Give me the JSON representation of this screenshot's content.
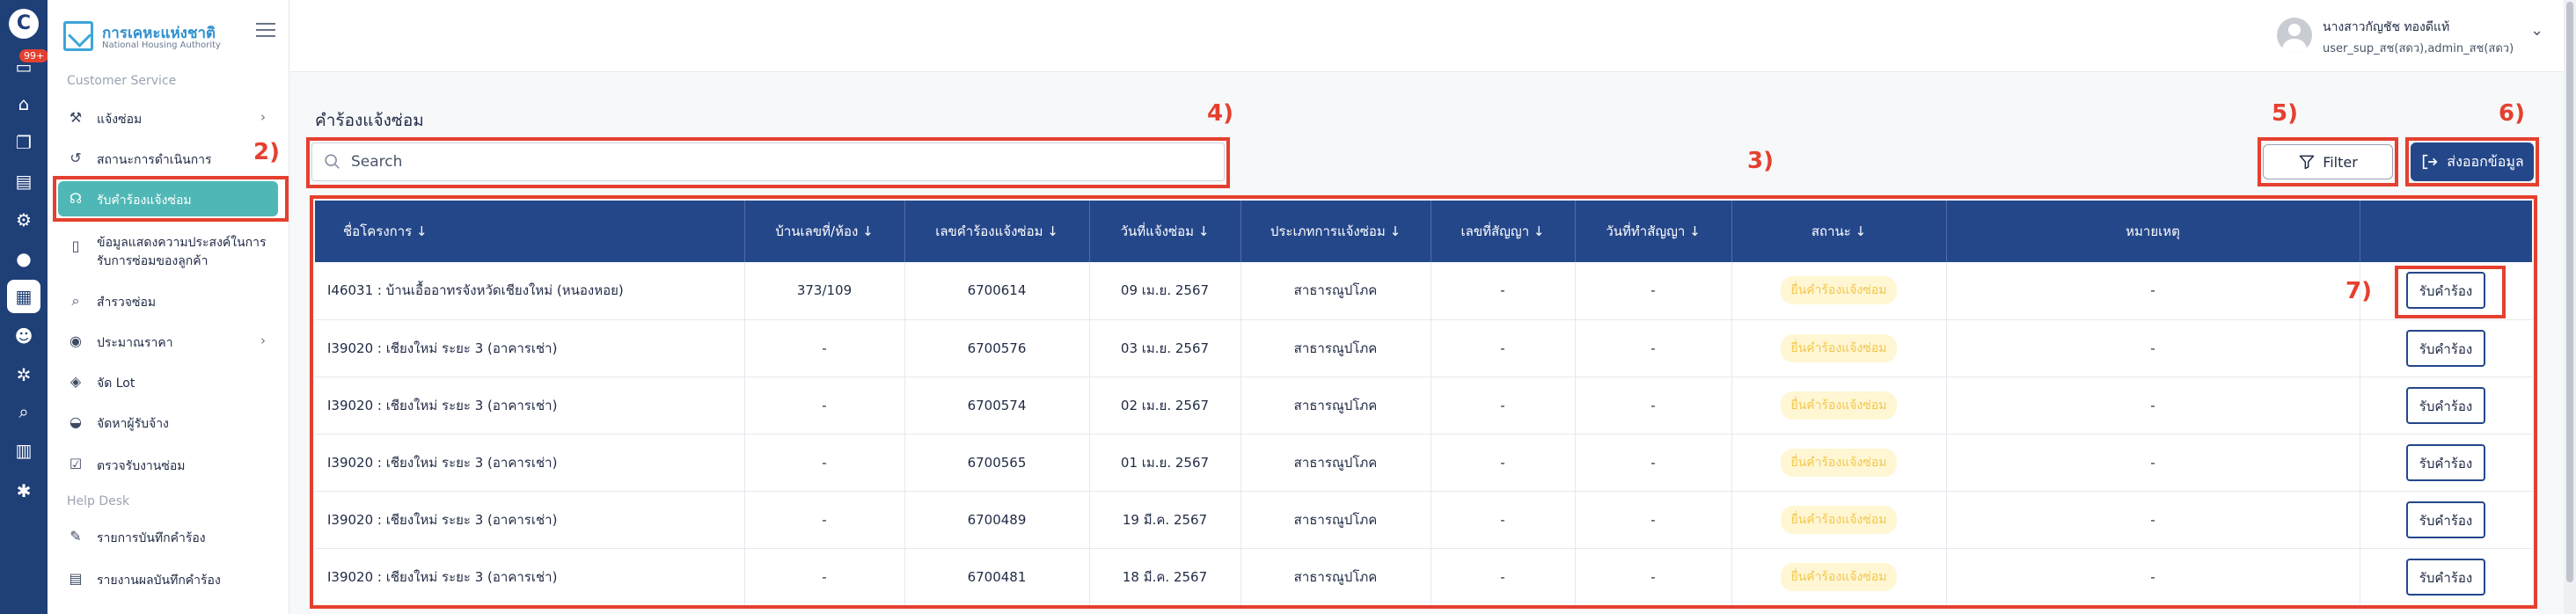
{
  "app": {
    "brand_name": "การเคหะแห่งชาติ",
    "brand_sub": "National Housing Authority",
    "notification_badge": "99+"
  },
  "sidebar": {
    "section_customer_service": "Customer Service",
    "section_help_desk": "Help Desk",
    "items": [
      {
        "label": "แจ้งซ่อม",
        "icon": "wrench-icon"
      },
      {
        "label": "สถานะการดำเนินการ",
        "icon": "history-icon"
      },
      {
        "label": "รับคำร้องแจ้งซ่อม",
        "icon": "headset-icon"
      },
      {
        "label": "ข้อมูลแสดงความประสงค์ในการรับการซ่อมของลูกค้า",
        "icon": "document-icon"
      },
      {
        "label": "สำรวจซ่อม",
        "icon": "search-icon"
      },
      {
        "label": "ประมาณราคา",
        "icon": "coin-icon"
      },
      {
        "label": "จัด Lot",
        "icon": "layers-icon"
      },
      {
        "label": "จัดหาผู้รับจ้าง",
        "icon": "pot-icon"
      },
      {
        "label": "ตรวจรับงานซ่อม",
        "icon": "checklist-icon"
      },
      {
        "label": "รายการบันทึกคำร้อง",
        "icon": "edit-icon"
      },
      {
        "label": "รายงานผลบันทึกคำร้อง",
        "icon": "report-icon"
      }
    ]
  },
  "header": {
    "user_name": "นางสาวกัญชัช ทองดีแท้",
    "user_role": "user_sup_สช(สดว),admin_สช(สดว)"
  },
  "page": {
    "title": "คำร้องแจ้งซ่อม",
    "search_placeholder": "Search",
    "filter_label": "Filter",
    "export_label": "ส่งออกข้อมูล"
  },
  "annotations": {
    "a2": "2)",
    "a3": "3)",
    "a4": "4)",
    "a5": "5)",
    "a6": "6)",
    "a7": "7)"
  },
  "table": {
    "columns": [
      "ชื่อโครงการ",
      "บ้านเลขที่/ห้อง",
      "เลขคำร้องแจ้งซ่อม",
      "วันที่แจ้งซ่อม",
      "ประเภทการแจ้งซ่อม",
      "เลขที่สัญญา",
      "วันที่ทำสัญญา",
      "สถานะ",
      "หมายเหตุ",
      ""
    ],
    "rows": [
      {
        "project": "I46031 : บ้านเอื้ออาทรจังหวัดเชียงใหม่ (หนองหอย)",
        "house": "373/109",
        "request_no": "6700614",
        "date": "09 เม.ย. 2567",
        "type": "สาธารณูปโภค",
        "contract_no": "-",
        "contract_date": "-",
        "status": "ยื่นคำร้องแจ้งซ่อม",
        "note": "-",
        "action": "รับคำร้อง"
      },
      {
        "project": "I39020 : เชียงใหม่ ระยะ 3 (อาคารเช่า)",
        "house": "-",
        "request_no": "6700576",
        "date": "03 เม.ย. 2567",
        "type": "สาธารณูปโภค",
        "contract_no": "-",
        "contract_date": "-",
        "status": "ยื่นคำร้องแจ้งซ่อม",
        "note": "-",
        "action": "รับคำร้อง"
      },
      {
        "project": "I39020 : เชียงใหม่ ระยะ 3 (อาคารเช่า)",
        "house": "-",
        "request_no": "6700574",
        "date": "02 เม.ย. 2567",
        "type": "สาธารณูปโภค",
        "contract_no": "-",
        "contract_date": "-",
        "status": "ยื่นคำร้องแจ้งซ่อม",
        "note": "-",
        "action": "รับคำร้อง"
      },
      {
        "project": "I39020 : เชียงใหม่ ระยะ 3 (อาคารเช่า)",
        "house": "-",
        "request_no": "6700565",
        "date": "01 เม.ย. 2567",
        "type": "สาธารณูปโภค",
        "contract_no": "-",
        "contract_date": "-",
        "status": "ยื่นคำร้องแจ้งซ่อม",
        "note": "-",
        "action": "รับคำร้อง"
      },
      {
        "project": "I39020 : เชียงใหม่ ระยะ 3 (อาคารเช่า)",
        "house": "-",
        "request_no": "6700489",
        "date": "19 มี.ค. 2567",
        "type": "สาธารณูปโภค",
        "contract_no": "-",
        "contract_date": "-",
        "status": "ยื่นคำร้องแจ้งซ่อม",
        "note": "-",
        "action": "รับคำร้อง"
      },
      {
        "project": "I39020 : เชียงใหม่ ระยะ 3 (อาคารเช่า)",
        "house": "-",
        "request_no": "6700481",
        "date": "18 มี.ค. 2567",
        "type": "สาธารณูปโภค",
        "contract_no": "-",
        "contract_date": "-",
        "status": "ยื่นคำร้องแจ้งซ่อม",
        "note": "-",
        "action": "รับคำร้อง"
      }
    ]
  },
  "colors": {
    "primary": "#24478a",
    "rail": "#1f3f77",
    "active_item": "#4fb8b6",
    "annotation": "#e5402f",
    "status_bg": "#fff6d4",
    "status_text": "#f2c84b"
  }
}
